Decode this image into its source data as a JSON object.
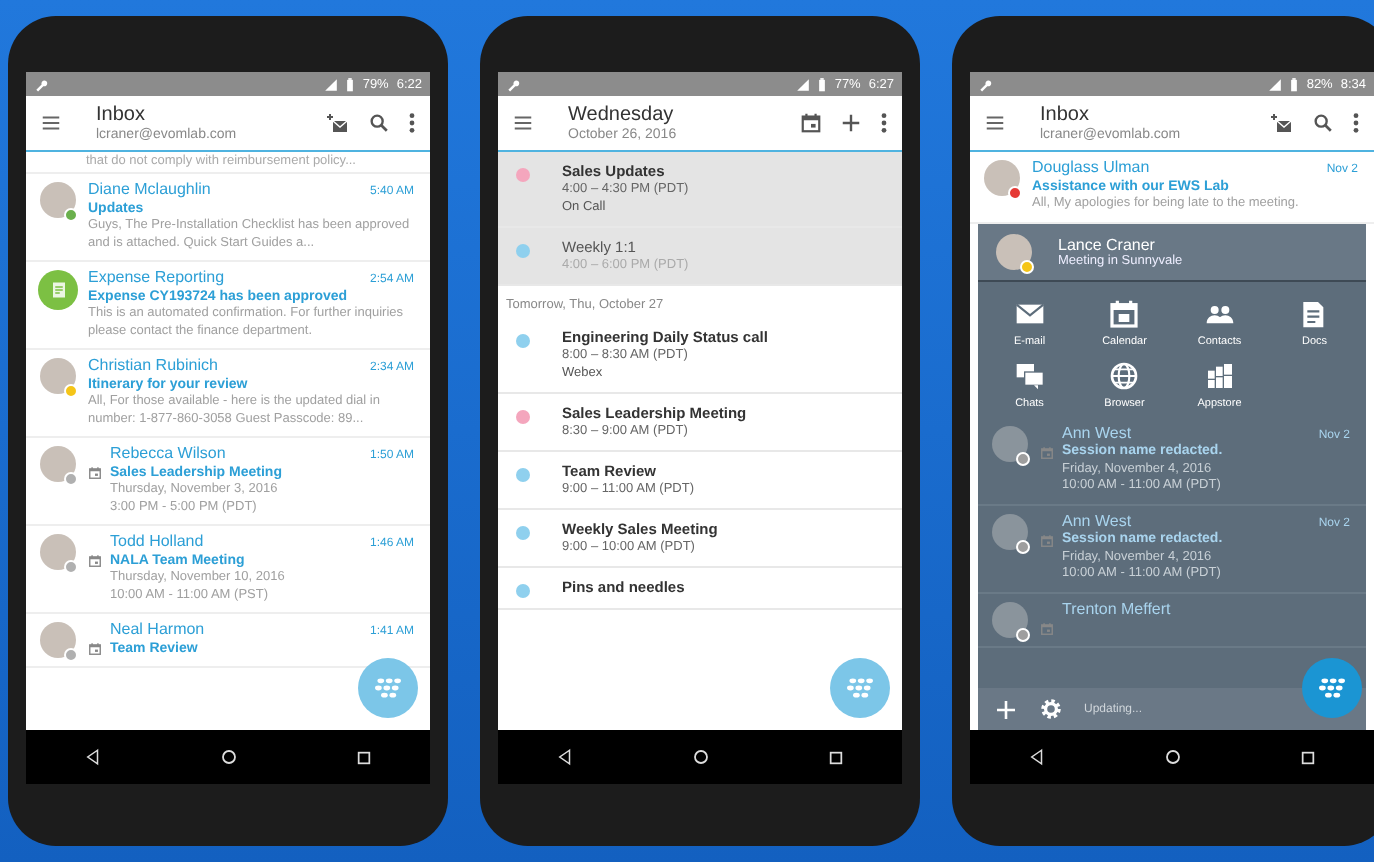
{
  "phones": [
    {
      "kind": "inbox",
      "status": {
        "battery": "79%",
        "time": "6:22"
      },
      "header": {
        "title": "Inbox",
        "subtitle": "lcraner@evomlab.com"
      },
      "snippet": "that do not comply with reimbursement policy...",
      "messages": [
        {
          "kind": "person",
          "sender": "Diane Mclaughlin",
          "time": "5:40 AM",
          "subject": "Updates",
          "lines": [
            "Guys, The Pre-Installation Checklist has been approved and is attached. Quick Start Guides a..."
          ],
          "color": "#6ab04c"
        },
        {
          "kind": "app",
          "sender": "Expense Reporting",
          "time": "2:54 AM",
          "subject": "Expense CY193724 has been approved",
          "lines": [
            "This is an automated confirmation. For further inquiries please contact the finance department."
          ]
        },
        {
          "kind": "person",
          "sender": "Christian Rubinich",
          "time": "2:34 AM",
          "subject": "Itinerary for your review",
          "lines": [
            "All, For those available - here is the updated dial in number: 1-877-860-3058 Guest Passcode: 89..."
          ],
          "color": "#f5c518"
        },
        {
          "kind": "meeting",
          "sender": "Rebecca Wilson",
          "time": "1:50 AM",
          "subject": "Sales Leadership Meeting",
          "lines": [
            "Thursday, November 3, 2016",
            "3:00 PM - 5:00 PM (PDT)"
          ],
          "color": "#b0b0b0"
        },
        {
          "kind": "meeting",
          "sender": "Todd Holland",
          "time": "1:46 AM",
          "subject": "NALA Team Meeting",
          "lines": [
            "Thursday, November 10, 2016",
            "10:00 AM - 11:00 AM (PST)"
          ],
          "color": "#b0b0b0"
        },
        {
          "kind": "meeting",
          "sender": "Neal Harmon",
          "time": "1:41 AM",
          "subject": "Team Review",
          "color": "#b0b0b0"
        }
      ]
    },
    {
      "kind": "calendar",
      "status": {
        "battery": "77%",
        "time": "6:27"
      },
      "header": {
        "title": "Wednesday",
        "subtitle": "October 26, 2016"
      },
      "sections": [
        {
          "past": true,
          "events": [
            {
              "title": "Sales Updates",
              "time": "4:00 – 4:30 PM (PDT)",
              "location": "On Call",
              "color": "#f4a6bd",
              "faded": false
            },
            {
              "title": "Weekly 1:1",
              "time": "4:00 – 6:00 PM (PDT)",
              "color": "#8fd0ee",
              "faded": true
            }
          ]
        },
        {
          "past": false,
          "heading": "Tomorrow, Thu, October 27",
          "events": [
            {
              "title": "Engineering Daily Status call",
              "time": "8:00 – 8:30 AM (PDT)",
              "location": "Webex",
              "color": "#8fd0ee",
              "faded": false
            },
            {
              "title": "Sales Leadership Meeting",
              "time": "8:30 – 9:00 AM (PDT)",
              "color": "#f4a6bd",
              "faded": false
            },
            {
              "title": "Team Review",
              "time": "9:00 – 11:00 AM (PDT)",
              "color": "#8fd0ee",
              "faded": false
            },
            {
              "title": "Weekly Sales Meeting",
              "time": "9:00 – 10:00 AM (PDT)",
              "color": "#8fd0ee",
              "faded": false
            },
            {
              "title": "Pins and needles",
              "color": "#8fd0ee",
              "faded": false
            }
          ]
        }
      ]
    },
    {
      "kind": "launcher",
      "status": {
        "battery": "82%",
        "time": "8:34"
      },
      "header": {
        "title": "Inbox",
        "subtitle": "lcraner@evomlab.com"
      },
      "messages": [
        {
          "kind": "person",
          "sender": "Douglass Ulman",
          "time": "Nov 2",
          "subject": "Assistance with our EWS Lab",
          "lines": [
            "All, My apologies for being late to the meeting."
          ],
          "color": "#e53935"
        }
      ],
      "panel": {
        "user": {
          "name": "Lance Craner",
          "status": "Meeting in Sunnyvale",
          "color": "#f5c518"
        },
        "apps": [
          {
            "kind": "email",
            "label": "E-mail"
          },
          {
            "kind": "calendar",
            "label": "Calendar"
          },
          {
            "kind": "contacts",
            "label": "Contacts"
          },
          {
            "kind": "docs",
            "label": "Docs"
          },
          {
            "kind": "chats",
            "label": "Chats"
          },
          {
            "kind": "browser",
            "label": "Browser"
          },
          {
            "kind": "appstore",
            "label": "Appstore"
          }
        ],
        "messages": [
          {
            "kind": "meeting",
            "sender": "Ann West",
            "time": "Nov 2",
            "subject": "Session name redacted.",
            "lines": [
              "Friday, November 4, 2016",
              "10:00 AM - 11:00 AM (PDT)"
            ],
            "color": "#9e9e9e"
          },
          {
            "kind": "meeting",
            "sender": "Ann West",
            "time": "Nov 2",
            "subject": "Session name redacted.",
            "lines": [
              "Friday, November 4, 2016",
              "10:00 AM - 11:00 AM (PDT)"
            ],
            "color": "#9e9e9e"
          },
          {
            "kind": "meeting",
            "sender": "Trenton Meffert",
            "color": "#9e9e9e"
          }
        ],
        "footer": "Updating..."
      }
    }
  ]
}
